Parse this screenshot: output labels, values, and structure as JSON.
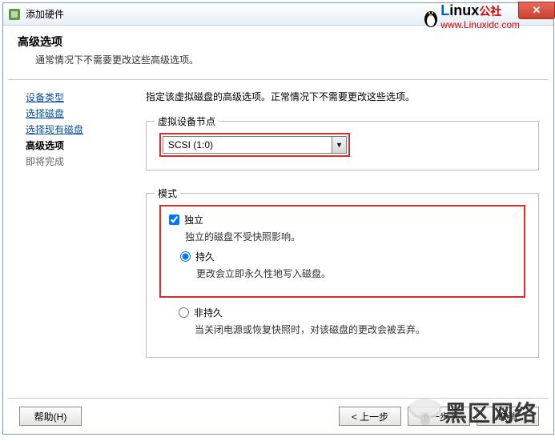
{
  "titlebar": {
    "title": "添加硬件"
  },
  "header": {
    "title": "高级选项",
    "desc": "通常情况下不需要更改这些高级选项。"
  },
  "sidebar": {
    "steps": [
      {
        "label": "设备类型"
      },
      {
        "label": "选择磁盘"
      },
      {
        "label": "选择现有磁盘"
      },
      {
        "label": "高级选项"
      },
      {
        "label": "即将完成"
      }
    ]
  },
  "main": {
    "instruction": "指定该虚拟磁盘的高级选项。正常情况下不需要更改这些选项。",
    "vdev": {
      "legend": "虚拟设备节点",
      "value": "SCSI (1:0)"
    },
    "mode": {
      "legend": "模式",
      "independent": {
        "label": "独立",
        "hint": "独立的磁盘不受快照影响。"
      },
      "persistent": {
        "label": "持久",
        "hint": "更改会立即永久性地写入磁盘。"
      },
      "nonpersistent": {
        "label": "非持久",
        "hint": "当关闭电源或恢复快照时，对该磁盘的更改会被丢弃。"
      }
    }
  },
  "buttons": {
    "help": "帮助(H)",
    "back": "< 上一步",
    "next": "下一步 >",
    "cancel": "取消"
  },
  "watermark": {
    "brand_prefix": "L",
    "brand_rest": "inux",
    "brand_suffix": "公社",
    "url": "www.Linuxidc.com",
    "footer": "黑区网络"
  }
}
